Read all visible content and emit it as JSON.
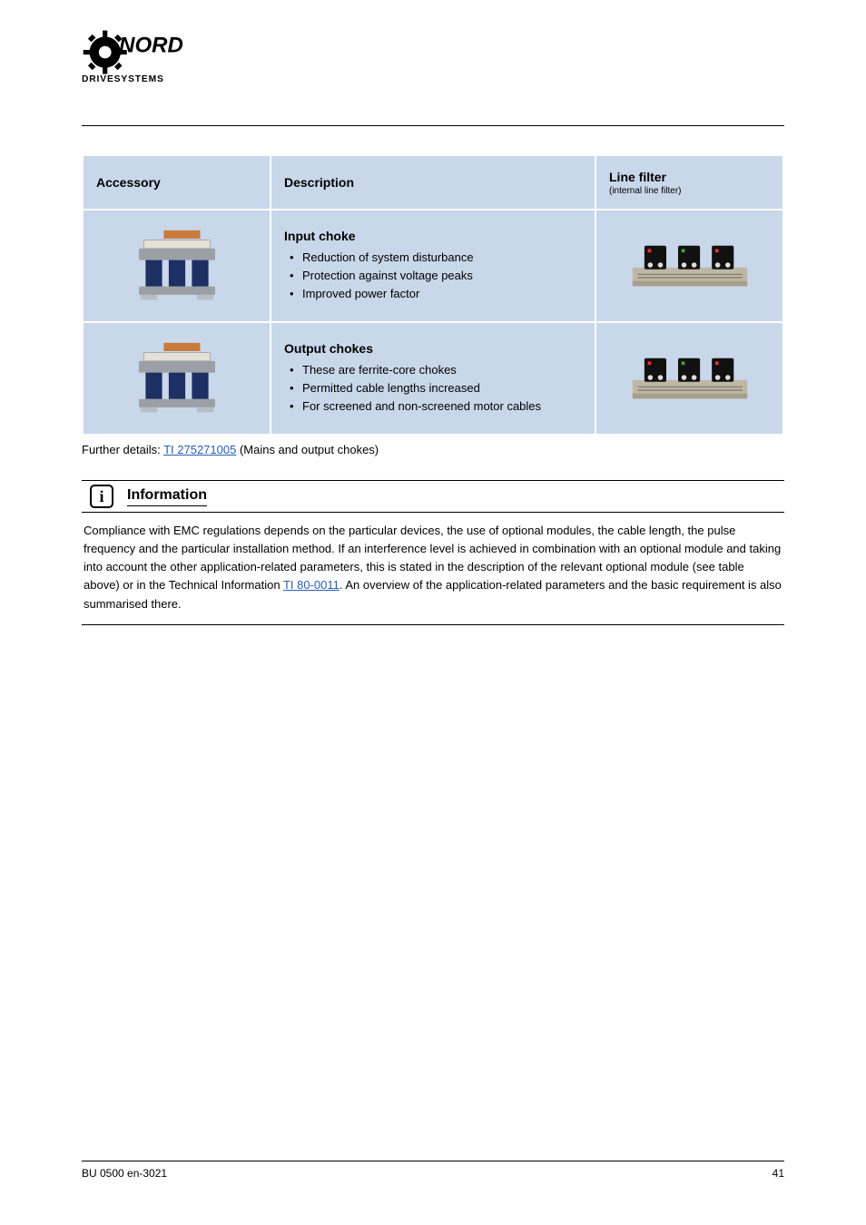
{
  "logo": {
    "top_text": "NORD",
    "bottom_text": "DRIVESYSTEMS"
  },
  "icons": {
    "info": "info-icon",
    "transformer": "transformer-icon",
    "line_filter": "line-filter-icon",
    "gear_logo": "nord-gear-logo-icon"
  },
  "table": {
    "headers": {
      "accessory": "Accessory",
      "description": "Description",
      "line_filter": "Line filter",
      "line_filter_sub": "(internal line filter)"
    },
    "rows": [
      {
        "title": "Input choke",
        "features": [
          "Reduction of system disturbance",
          "Protection against voltage peaks",
          "Improved power factor"
        ]
      },
      {
        "title": "Output chokes",
        "features": [
          "These are ferrite-core chokes",
          "Permitted cable lengths increased",
          "For screened and non-screened motor cables"
        ]
      }
    ]
  },
  "details_line": {
    "prefix": "Further details: ",
    "link_text": "TI 275271005",
    "suffix": " (Mains and output chokes)"
  },
  "info": {
    "heading": "Information",
    "body_1": "Compliance with EMC regulations depends on the particular devices, the use of optional modules, the cable length, the pulse frequency and the particular installation method. If an interference level is achieved in combination with an optional module and taking into account the other application-related parameters, this is stated in the description of the relevant optional module (see table above) or in the Technical Information ",
    "body_link": "TI 80-0011",
    "body_2": ". An overview of the application-related parameters and the basic requirement is also summarised there."
  },
  "footer": {
    "left": "BU 0500 en-3021",
    "right": "41"
  }
}
